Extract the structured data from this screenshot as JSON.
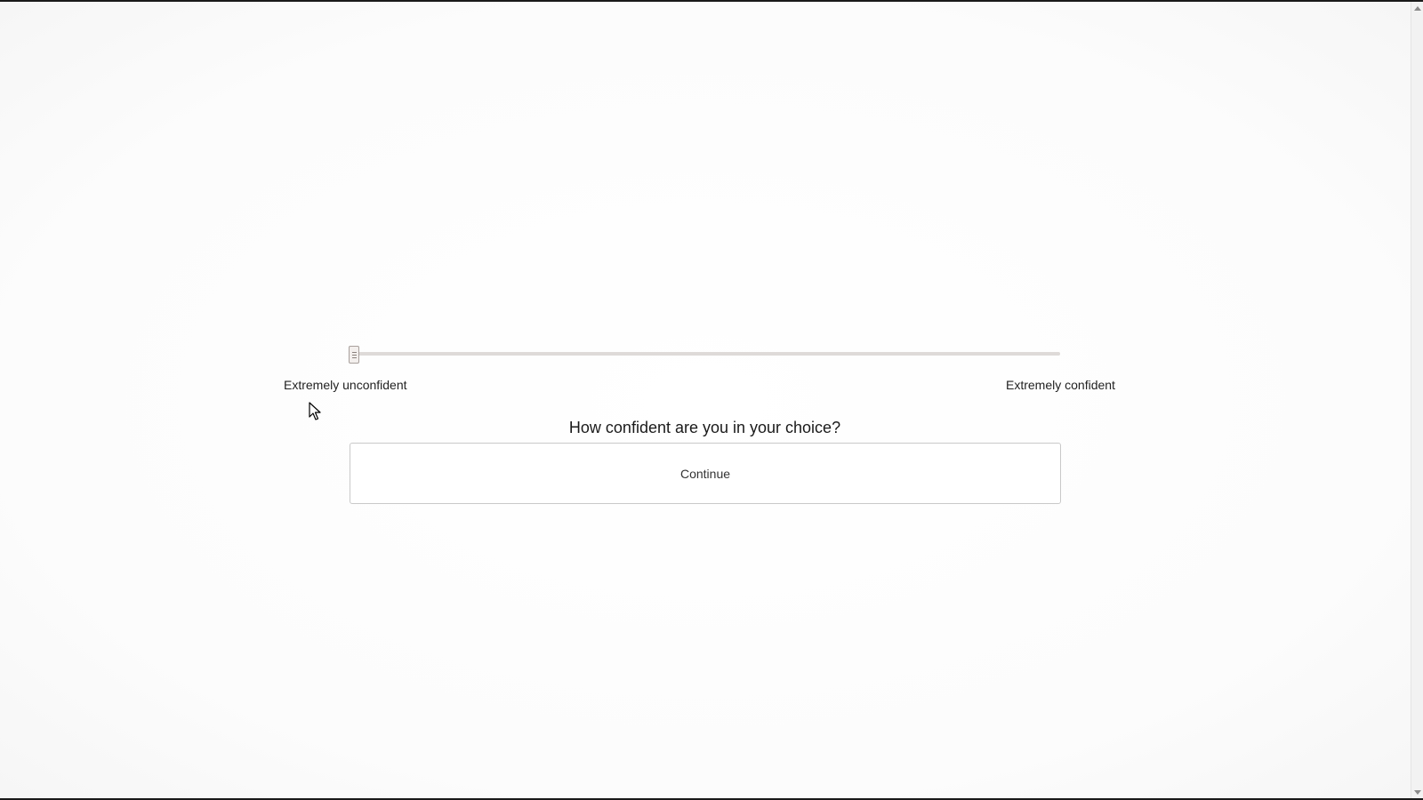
{
  "slider": {
    "min_label": "Extremely unconfident",
    "max_label": "Extremely confident",
    "value_fraction": 0.0
  },
  "question": {
    "text": "How confident are you in your choice?"
  },
  "continue_button": {
    "label": "Continue"
  },
  "colors": {
    "track": "#dedad8",
    "thumb": "#f3efed",
    "background": "#fdfdfd"
  },
  "icons": {
    "cursor": "mouse-pointer-icon",
    "scroll_up": "chevron-up-icon",
    "scroll_down": "chevron-down-icon"
  }
}
